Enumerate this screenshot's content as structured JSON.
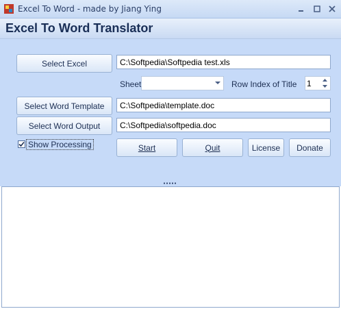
{
  "window": {
    "title": "Excel To Word - made by Jiang Ying",
    "icon": "app-icon",
    "controls": [
      "minimize-icon",
      "maximize-icon",
      "close-icon"
    ]
  },
  "header": {
    "title": "Excel To Word Translator"
  },
  "form": {
    "select_excel_label": "Select Excel",
    "excel_path": "C:\\Softpedia\\Softpedia test.xls",
    "sheet_label": "Sheet",
    "sheet_value": "",
    "row_index_label": "Row Index of Title",
    "row_index_value": "1",
    "select_template_label": "Select Word Template",
    "template_path": "C:\\Softpedia\\template.doc",
    "select_output_label": "Select Word Output",
    "output_path": "C:\\Softpedia\\softpedia.doc",
    "show_processing_label": "Show Processing",
    "show_processing_checked": true
  },
  "actions": {
    "start": "Start",
    "quit": "Quit",
    "license": "License",
    "donate": "Donate"
  },
  "output_log": ""
}
